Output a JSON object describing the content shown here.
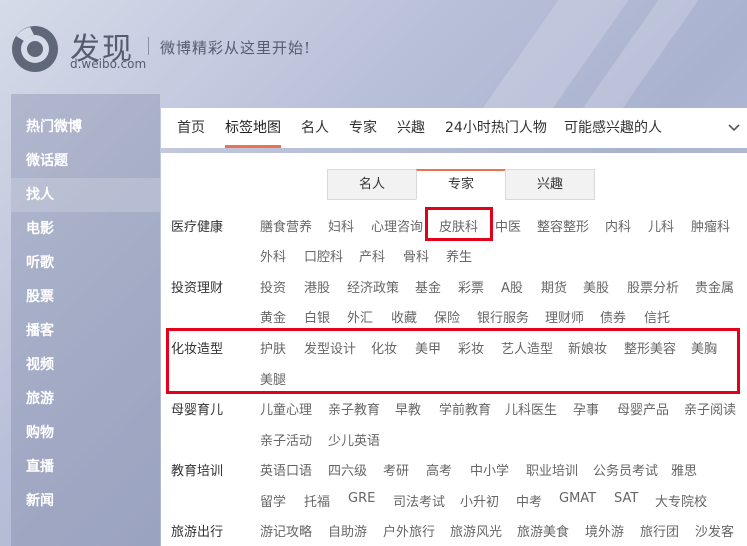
{
  "header": {
    "title": "发现",
    "domain": "d.weibo.com",
    "slogan": "微博精彩从这里开始!"
  },
  "sidebar": {
    "items": [
      {
        "label": "热门微博"
      },
      {
        "label": "微话题"
      },
      {
        "label": "找人"
      },
      {
        "label": "电影"
      },
      {
        "label": "听歌"
      },
      {
        "label": "股票"
      },
      {
        "label": "播客"
      },
      {
        "label": "视频"
      },
      {
        "label": "旅游"
      },
      {
        "label": "购物"
      },
      {
        "label": "直播"
      },
      {
        "label": "新闻"
      }
    ],
    "active_index": 2
  },
  "tabs": {
    "items": [
      {
        "label": "首页"
      },
      {
        "label": "标签地图"
      },
      {
        "label": "名人"
      },
      {
        "label": "专家"
      },
      {
        "label": "兴趣"
      },
      {
        "label": "24小时热门人物"
      },
      {
        "label": "可能感兴趣的人"
      }
    ],
    "active_index": 1
  },
  "segments": {
    "items": [
      {
        "label": "名人"
      },
      {
        "label": "专家"
      },
      {
        "label": "兴趣"
      }
    ],
    "active_index": 1
  },
  "categories": [
    {
      "name": "医疗健康",
      "rows": [
        [
          "膳食营养",
          "妇科",
          "心理咨询",
          "皮肤科",
          "中医",
          "整容整形",
          "内科",
          "儿科",
          "肿瘤科"
        ],
        [
          "外科",
          "口腔科",
          "产科",
          "骨科",
          "养生"
        ]
      ]
    },
    {
      "name": "投资理财",
      "rows": [
        [
          "投资",
          "港股",
          "经济政策",
          "基金",
          "彩票",
          "A股",
          "期货",
          "美股",
          "股票分析",
          "贵金属"
        ],
        [
          "黄金",
          "白银",
          "外汇",
          "收藏",
          "保险",
          "银行服务",
          "理财师",
          "债券",
          "信托"
        ]
      ]
    },
    {
      "name": "化妆造型",
      "rows": [
        [
          "护肤",
          "发型设计",
          "化妆",
          "美甲",
          "彩妆",
          "艺人造型",
          "新娘妆",
          "整形美容",
          "美胸"
        ],
        [
          "美腿"
        ]
      ]
    },
    {
      "name": "母婴育儿",
      "rows": [
        [
          "儿童心理",
          "亲子教育",
          "早教",
          "学前教育",
          "儿科医生",
          "孕事",
          "母婴产品",
          "亲子阅读"
        ],
        [
          "亲子活动",
          "少儿英语"
        ]
      ]
    },
    {
      "name": "教育培训",
      "rows": [
        [
          "英语口语",
          "四六级",
          "考研",
          "高考",
          "中小学",
          "职业培训",
          "公务员考试",
          "雅思"
        ],
        [
          "留学",
          "托福",
          "GRE",
          "司法考试",
          "小升初",
          "中考",
          "GMAT",
          "SAT",
          "大专院校"
        ]
      ]
    },
    {
      "name": "旅游出行",
      "rows": [
        [
          "游记攻略",
          "自助游",
          "户外旅行",
          "旅游风光",
          "旅游美食",
          "境外游",
          "旅行团",
          "沙发客"
        ]
      ]
    }
  ],
  "highlights": [
    "皮肤科",
    "化妆造型"
  ],
  "colors": {
    "accent": "#eb7350",
    "highlight": "#e3001b",
    "nav_text": "#ffffff"
  }
}
